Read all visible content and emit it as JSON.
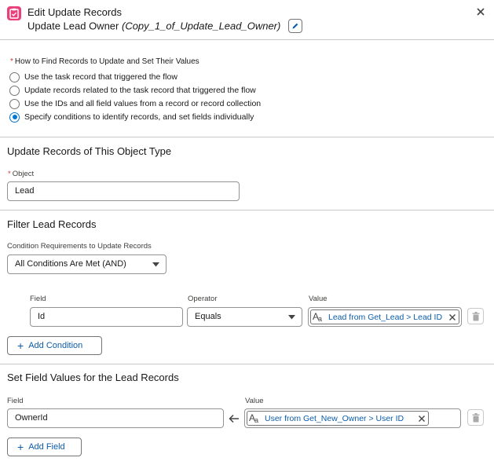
{
  "header": {
    "title": "Edit Update Records",
    "element_label": "Update Lead Owner",
    "element_api_name": "(Copy_1_of_Update_Lead_Owner)"
  },
  "find_records": {
    "label": "How to Find Records to Update and Set Their Values",
    "options": [
      {
        "label": "Use the task record that triggered the flow",
        "selected": false
      },
      {
        "label": "Update records related to the task record that triggered the flow",
        "selected": false
      },
      {
        "label": "Use the IDs and all field values from a record or record collection",
        "selected": false
      },
      {
        "label": "Specify conditions to identify records, and set fields individually",
        "selected": true
      }
    ]
  },
  "object_section": {
    "title": "Update Records of This Object Type",
    "object_label": "Object",
    "object_value": "Lead"
  },
  "filter_section": {
    "title": "Filter Lead Records",
    "condition_label": "Condition Requirements to Update Records",
    "condition_value": "All Conditions Are Met (AND)",
    "col_field": "Field",
    "col_operator": "Operator",
    "col_value": "Value",
    "row": {
      "field": "Id",
      "operator": "Equals",
      "value": "Lead from Get_Lead > Lead ID"
    },
    "add_condition": "Add Condition"
  },
  "set_section": {
    "title": "Set Field Values for the Lead Records",
    "col_field": "Field",
    "col_value": "Value",
    "row": {
      "field": "OwnerId",
      "value": "User from Get_New_Owner > User ID"
    },
    "add_field": "Add Field"
  },
  "colors": {
    "accent": "#0176d3",
    "link": "#0b5cab",
    "app_icon": "#e8407a",
    "required": "#c23934",
    "divider": "#c9c9c9"
  }
}
